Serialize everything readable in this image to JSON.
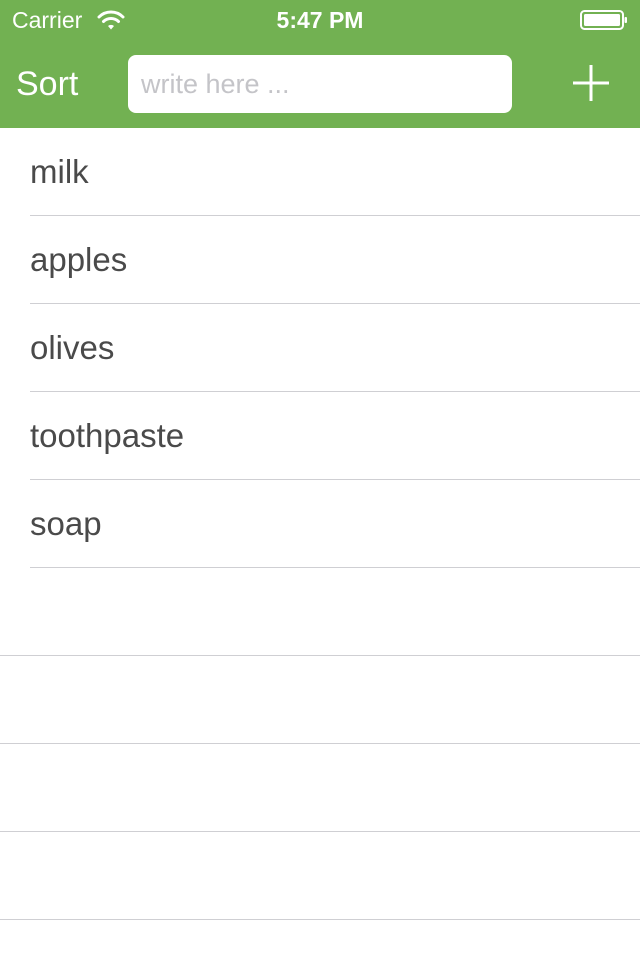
{
  "status_bar": {
    "carrier": "Carrier",
    "time": "5:47 PM",
    "icons": [
      "wifi-icon",
      "battery-icon"
    ]
  },
  "nav_bar": {
    "sort_label": "Sort",
    "search_placeholder": "write here ...",
    "search_value": "",
    "add_icon": "plus-icon"
  },
  "items": [
    {
      "label": "milk"
    },
    {
      "label": "apples"
    },
    {
      "label": "olives"
    },
    {
      "label": "toothpaste"
    },
    {
      "label": "soap"
    }
  ],
  "empty_rows": 4,
  "colors": {
    "accent": "#72b152",
    "text": "#4a4a4a",
    "separator": "#cfcfd3",
    "placeholder": "#c4c4c8"
  }
}
